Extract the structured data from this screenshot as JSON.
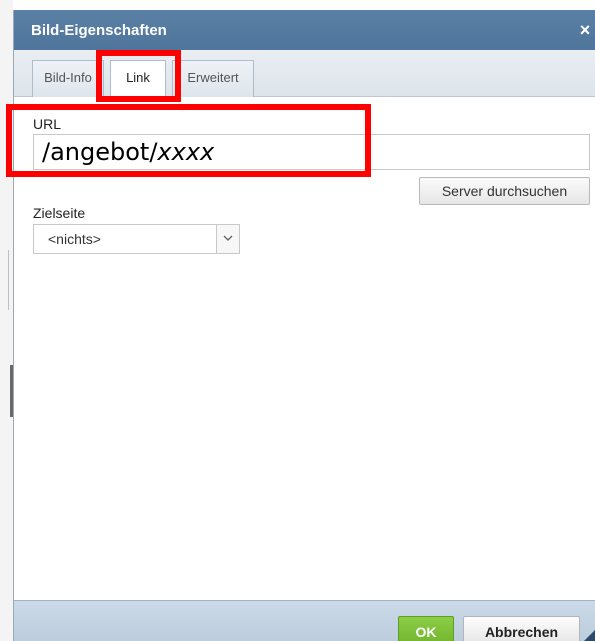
{
  "dialog": {
    "title": "Bild-Eigenschaften",
    "close_symbol": "×"
  },
  "tabs": [
    {
      "label": "Bild-Info",
      "active": false
    },
    {
      "label": "Link",
      "active": true
    },
    {
      "label": "Erweitert",
      "active": false
    }
  ],
  "link": {
    "url_label": "URL",
    "url_value_plain": "/angebot/",
    "url_value_italic": "xxxx",
    "browse_server_label": "Server durchsuchen",
    "target_label": "Zielseite",
    "target_selected": "<nichts>"
  },
  "footer": {
    "ok_label": "OK",
    "cancel_label": "Abbrechen"
  },
  "colors": {
    "titlebar": "#54799f",
    "ok_button": "#7abf36",
    "annotation": "#ff0000"
  }
}
